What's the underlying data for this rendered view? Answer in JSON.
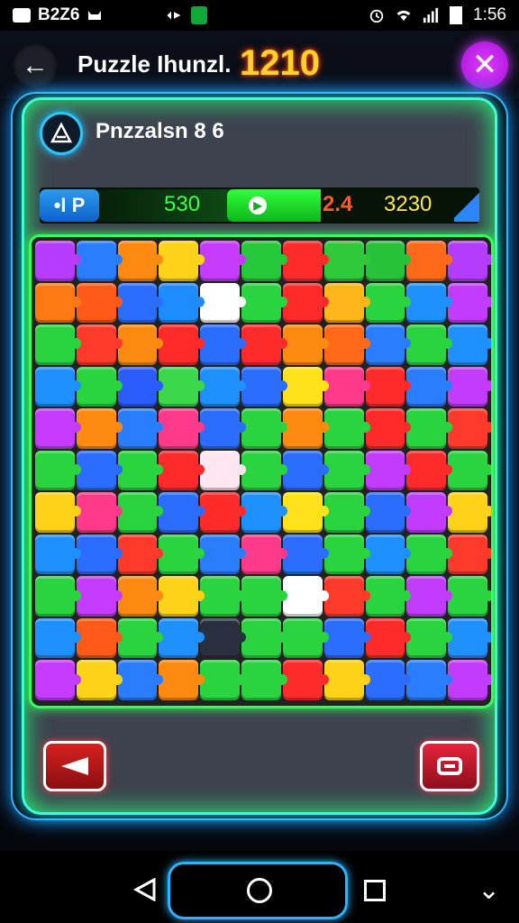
{
  "status_bar": {
    "carrier": "B2Z6",
    "time": "1:56"
  },
  "header": {
    "title": "Puzzle Ihunzl.",
    "score": "1210"
  },
  "level": {
    "title": "Pnzzalsn 8 6"
  },
  "progress": {
    "left_label": "•I P",
    "value1": "530",
    "value2": "2.4",
    "value3": "3230"
  },
  "colors": {
    "accent_green": "#35ff5a",
    "accent_blue": "#2fb3ff",
    "score_yellow": "#ffd32a",
    "close_purple": "#c93bff"
  },
  "icons": {
    "back": "arrow-left-icon",
    "close": "close-icon",
    "level": "puzzle-logo-icon",
    "prev": "play-reverse-icon",
    "stop": "stop-icon"
  },
  "board": {
    "rows": 11,
    "cols": 11,
    "colors": [
      "#b83cff",
      "#2a7dff",
      "#ff8a12",
      "#ffd21a",
      "#c63cff",
      "#25c93a",
      "#ff2a2a",
      "#2fc93a",
      "#28c23a",
      "#ff6a1a",
      "#b43cff",
      "#ff7a12",
      "#ff5a18",
      "#2a6dff",
      "#1e8cff",
      "#ffffff",
      "#2ad43e",
      "#ff2a2a",
      "#ffb61a",
      "#2ad43e",
      "#1e90ff",
      "#c23cff",
      "#2ad43e",
      "#ff3a2a",
      "#ff8a12",
      "#ff2a2a",
      "#2a6dff",
      "#ff2a2a",
      "#ff8a12",
      "#ff6a1a",
      "#2a7dff",
      "#2ad43e",
      "#1e90ff",
      "#1e90ff",
      "#2ad43e",
      "#2a5dff",
      "#3ad84a",
      "#1e90ff",
      "#2a6dff",
      "#ffe21a",
      "#ff3a8a",
      "#ff2a2a",
      "#2a7dff",
      "#c23cff",
      "#c63cff",
      "#ff8a12",
      "#2a7dff",
      "#ff3a8a",
      "#2a6dff",
      "#2ad43e",
      "#ff8a12",
      "#2ad43e",
      "#ff2a2a",
      "#2ad43e",
      "#ff3a2a",
      "#2ad43e",
      "#2a6dff",
      "#2ad43e",
      "#ff2a2a",
      "#ffe6f0",
      "#2ad43e",
      "#2a6dff",
      "#2ad43e",
      "#c23cff",
      "#ff2a2a",
      "#2ad43e",
      "#ffd21a",
      "#ff3a8a",
      "#2ad43e",
      "#2a6dff",
      "#ff2a2a",
      "#1e90ff",
      "#ffe21a",
      "#2ad43e",
      "#2a6dff",
      "#c23cff",
      "#ffd21a",
      "#1e90ff",
      "#2a6dff",
      "#ff3a2a",
      "#2ad43e",
      "#2a7dff",
      "#ff3a8a",
      "#2a6dff",
      "#2ad43e",
      "#1e90ff",
      "#2ad43e",
      "#ff3a2a",
      "#2ad43e",
      "#c63cff",
      "#ff8a12",
      "#ffd21a",
      "#2ad43e",
      "#2ad43e",
      "#ffffff",
      "#ff3a2a",
      "#2ad43e",
      "#c23cff",
      "#2ad43e",
      "#1e90ff",
      "#ff5a18",
      "#2ad43e",
      "#1e90ff",
      "#2a3040",
      "#2ad43e",
      "#2ad43e",
      "#2a6dff",
      "#ff2a2a",
      "#2ad43e",
      "#1e90ff",
      "#c63cff",
      "#ffd21a",
      "#2a7dff",
      "#ff8a12",
      "#2ad43e",
      "#2ad43e",
      "#ff2a2a",
      "#ffd21a",
      "#2a6dff",
      "#2a7dff",
      "#c23cff"
    ]
  }
}
